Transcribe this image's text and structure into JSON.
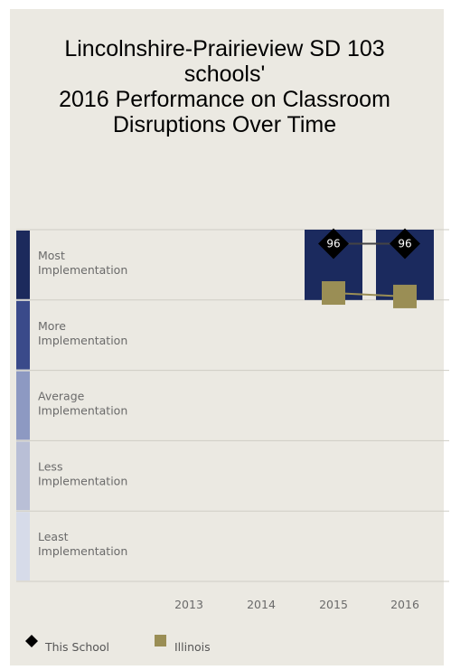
{
  "title_lines": [
    "Lincolnshire-Prairieview SD 103",
    "schools'",
    "2016 Performance on Classroom",
    "Disruptions Over Time"
  ],
  "colors": {
    "card_bg": "#ebe9e2",
    "bar": "#1b2a5e",
    "school_marker": "#000000",
    "illinois_marker": "#9a8e55",
    "band_colors": [
      "#1c2a5c",
      "#3a4a8a",
      "#8d99c2",
      "#b9bfd6",
      "#d6dbe9"
    ]
  },
  "chart_data": {
    "type": "bar",
    "title": "Lincolnshire-Prairieview SD 103 schools' 2016 Performance on Classroom Disruptions Over Time",
    "categories": [
      "2013",
      "2014",
      "2015",
      "2016"
    ],
    "ylim": [
      0,
      100
    ],
    "bands": [
      {
        "label_line1": "Most",
        "label_line2": "Implementation",
        "range": [
          80,
          100
        ]
      },
      {
        "label_line1": "More",
        "label_line2": "Implementation",
        "range": [
          60,
          80
        ]
      },
      {
        "label_line1": "Average",
        "label_line2": "Implementation",
        "range": [
          40,
          60
        ]
      },
      {
        "label_line1": "Less",
        "label_line2": "Implementation",
        "range": [
          20,
          40
        ]
      },
      {
        "label_line1": "Least",
        "label_line2": "Implementation",
        "range": [
          0,
          20
        ]
      }
    ],
    "series": [
      {
        "name": "This School",
        "type": "bar+line",
        "marker": "diamond",
        "values": [
          null,
          null,
          96,
          96
        ],
        "labels": [
          "",
          "",
          "96",
          "96"
        ]
      },
      {
        "name": "Illinois",
        "type": "line",
        "marker": "square",
        "values": [
          null,
          null,
          82,
          81
        ]
      }
    ],
    "legend_position": "bottom-left"
  },
  "legend": [
    {
      "name": "This School",
      "marker": "diamond"
    },
    {
      "name": "Illinois",
      "marker": "square"
    }
  ]
}
